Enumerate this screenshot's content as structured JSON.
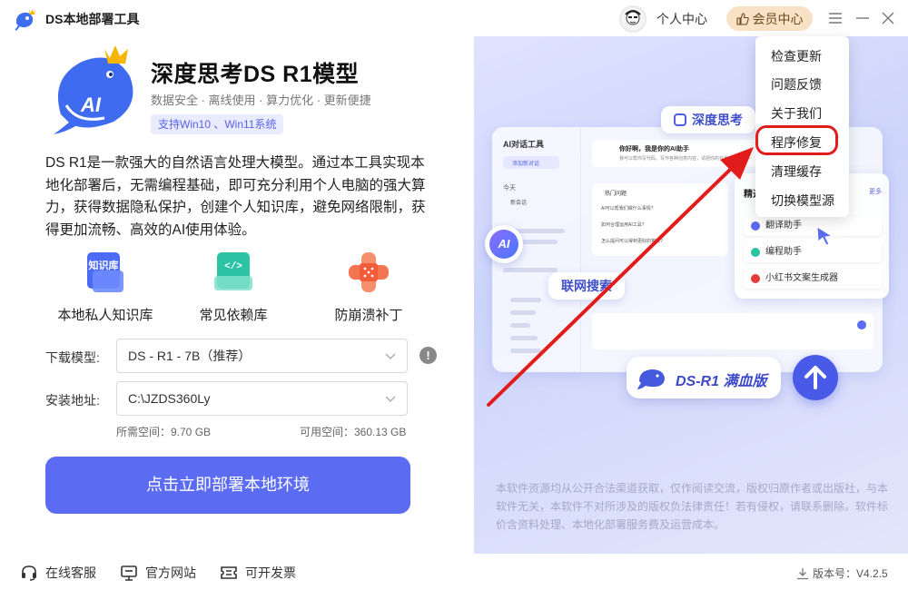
{
  "app": {
    "title": "DS本地部署工具"
  },
  "titlebar": {
    "personal_center": "个人中心",
    "vip_center": "会员中心",
    "icons": [
      "menu-icon",
      "minimize-icon",
      "close-icon"
    ]
  },
  "menu": {
    "items": [
      "检查更新",
      "问题反馈",
      "关于我们",
      "程序修复",
      "清理缓存",
      "切换模型源"
    ],
    "highlighted": "程序修复"
  },
  "product": {
    "title": "深度思考DS R1模型",
    "features_line": "数据安全 · 离线使用 · 算力优化 · 更新便捷",
    "support": "支持Win10 、Win11系统",
    "logo_text": "AI",
    "description": "DS R1是一款强大的自然语言处理大模型。通过本工具实现本地化部署后，无需编程基础，即可充分利用个人电脑的强大算力，获得数据隐私保护，创建个人知识库，避免网络限制，获得更加流畅、高效的AI使用体验。"
  },
  "features": [
    {
      "label": "本地私人知识库",
      "icon": "knowledge-base-icon",
      "icon_text": "知识库",
      "color": "#4b6bf5"
    },
    {
      "label": "常见依赖库",
      "icon": "dependency-library-icon",
      "icon_text": "</>",
      "color": "#2cc3a5"
    },
    {
      "label": "防崩溃补丁",
      "icon": "crash-patch-icon",
      "icon_text": "",
      "color": "#f4754f"
    }
  ],
  "form": {
    "model_label": "下载模型:",
    "model_value": "DS - R1 - 7B（推荐）",
    "path_label": "安装地址:",
    "path_value": "C:\\JZDS360Ly",
    "required_space": "所需空间：9.70 GB",
    "available_space": "可用空间：360.13 GB"
  },
  "deploy_button": "点击立即部署本地环境",
  "bottom": {
    "service": "在线客服",
    "website": "官方网站",
    "invoice": "可开发票",
    "version": "版本号：V4.2.5"
  },
  "preview": {
    "deep_think": "深度思考",
    "web_search": "联网搜索",
    "ai_chat_tool": "AI对话工具",
    "add_chat": "添加新对话",
    "today": "今天",
    "new_chat": "新会话",
    "greeting": "你好啊，我是你的AI助手",
    "greeting_sub": "我可以帮你写代码、写作各种创意内容，请把你的任务交给我吧～",
    "hot_questions": "热门问题",
    "q1": "AI可以帮我们做什么事情?",
    "q2": "如何合理运用AI工具?",
    "q3": "怎么提问可以得到更好的答案?",
    "selected_tools": "精选工具",
    "more": "更多",
    "tool1": "翻译助手",
    "tool2": "编程助手",
    "tool3": "小红书文案生成器",
    "banner_text": "DS-R1 满血版",
    "disclaimer": "本软件资源均从公开合法渠道获取，仅作阅读交流，版权归原作者或出版社，与本软件无关，本软件不对所涉及的版权负法律责任！若有侵权，请联系删除。软件标价含资料处理、本地化部署服务费及运营成本。"
  }
}
